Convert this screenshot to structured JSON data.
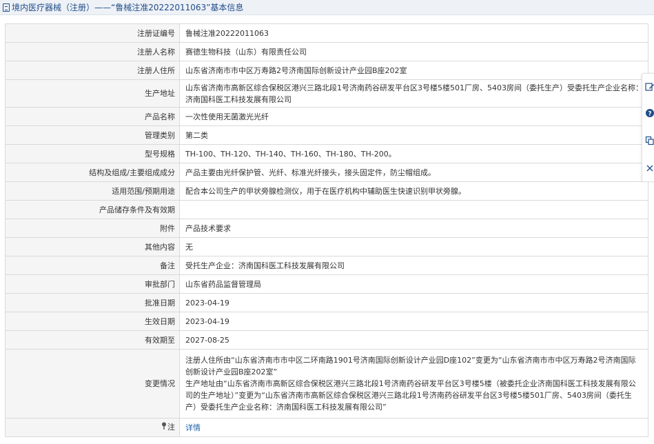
{
  "header": {
    "title": "境内医疗器械（注册）——“鲁械注准20222011063”基本信息"
  },
  "rows": [
    {
      "label": "注册证编号",
      "value": "鲁械注准20222011063"
    },
    {
      "label": "注册人名称",
      "value": "赛德生物科技（山东）有限责任公司"
    },
    {
      "label": "注册人住所",
      "value": "山东省济南市市中区万寿路2号济南国际创新设计产业园B座202室"
    },
    {
      "label": "生产地址",
      "value": "山东省济南市高新区综合保税区港兴三路北段1号济南药谷研发平台区3号楼5楼501厂房、5403房间（委托生产）受委托生产企业名称：济南国科医工科技发展有限公司"
    },
    {
      "label": "产品名称",
      "value": "一次性使用无菌激光光纤"
    },
    {
      "label": "管理类别",
      "value": "第二类"
    },
    {
      "label": "型号规格",
      "value": "TH-100、TH-120、TH-140、TH-160、TH-180、TH-200。"
    },
    {
      "label": "结构及组成/主要组成成分",
      "value": "产品主要由光纤保护管、光纤、标准光纤接头，接头固定件，防尘帽组成。"
    },
    {
      "label": "适用范围/预期用途",
      "value": "配合本公司生产的甲状旁腺检测仪，用于在医疗机构中辅助医生快速识别甲状旁腺。"
    },
    {
      "label": "产品储存条件及有效期",
      "value": ""
    },
    {
      "label": "附件",
      "value": "产品技术要求"
    },
    {
      "label": "其他内容",
      "value": "无"
    },
    {
      "label": "备注",
      "value": "受托生产企业：济南国科医工科技发展有限公司"
    },
    {
      "label": "审批部门",
      "value": "山东省药品监督管理局"
    },
    {
      "label": "批准日期",
      "value": "2023-04-19"
    },
    {
      "label": "生效日期",
      "value": "2023-04-19"
    },
    {
      "label": "有效期至",
      "value": "2027-08-25"
    }
  ],
  "change": {
    "label": "变更情况",
    "value": "注册人住所由“山东省济南市市中区二环南路1901号济南国际创新设计产业园D座102”变更为“山东省济南市市中区万寿路2号济南国际创新设计产业园B座202室”\n生产地址由“山东省济南市高新区综合保税区港兴三路北段1号济南药谷研发平台区3号楼5楼（被委托企业济南国科医工科技发展有限公司的生产地址）”变更为“山东省济南市高新区综合保税区港兴三路北段1号济南药谷研发平台区3号楼5楼501厂房、5403房间（委托生产）受委托生产企业名称：济南国科医工科技发展有限公司”"
  },
  "note_row": {
    "label": "注",
    "link": "详情"
  },
  "toolbar": {
    "icons": [
      "edit-icon",
      "help-icon",
      "copy-icon",
      "close-icon"
    ]
  }
}
